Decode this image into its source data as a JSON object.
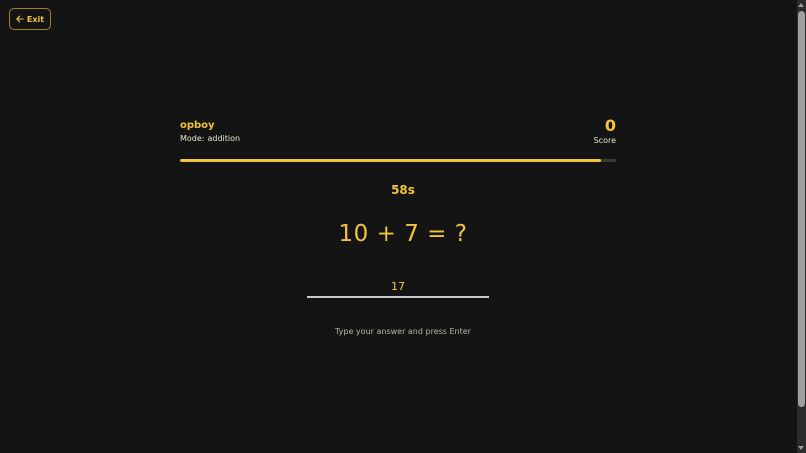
{
  "header": {
    "exit_label": "Exit",
    "exit_icon": "arrow-left-icon"
  },
  "player": {
    "name": "opboy",
    "mode_label": "Mode:",
    "mode_value": "addition"
  },
  "score": {
    "value": "0",
    "label": "Score"
  },
  "progress": {
    "fraction": 0.966
  },
  "timer": {
    "text": "58s"
  },
  "question": {
    "text": "10 + 7 = ?"
  },
  "answer": {
    "value": "17"
  },
  "hint": {
    "text": "Type your answer and press Enter"
  },
  "colors": {
    "accent": "#f2c43d",
    "background": "#141414",
    "track": "#3a3a3a"
  }
}
